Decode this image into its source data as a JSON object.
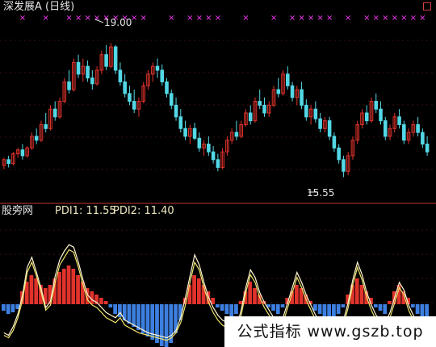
{
  "header": {
    "title": "深发展A (日线)",
    "corner_icon": "square-icon"
  },
  "chart_data": [
    {
      "type": "candlestick",
      "title": "深发展A (日线)",
      "annotations": {
        "high": "19.00",
        "low": "15.55"
      },
      "ylim": [
        15.0,
        19.4
      ],
      "colors": {
        "up": "#e0332c",
        "down": "#53d8e6",
        "marker": "#ff3cff"
      },
      "candles": [
        [
          15.85,
          16.05,
          15.75,
          16.0
        ],
        [
          16.0,
          16.1,
          15.8,
          15.9
        ],
        [
          15.9,
          16.2,
          15.85,
          16.15
        ],
        [
          16.15,
          16.3,
          16.05,
          16.25
        ],
        [
          16.25,
          16.4,
          16.0,
          16.1
        ],
        [
          16.1,
          16.35,
          16.05,
          16.3
        ],
        [
          16.3,
          16.7,
          16.25,
          16.6
        ],
        [
          16.6,
          16.8,
          16.4,
          16.5
        ],
        [
          16.5,
          17.0,
          16.45,
          16.9
        ],
        [
          16.9,
          17.2,
          16.7,
          16.8
        ],
        [
          16.8,
          17.4,
          16.75,
          17.3
        ],
        [
          17.3,
          17.5,
          17.0,
          17.1
        ],
        [
          17.1,
          17.6,
          17.05,
          17.5
        ],
        [
          17.5,
          18.1,
          17.45,
          18.0
        ],
        [
          18.0,
          18.3,
          17.7,
          17.8
        ],
        [
          17.8,
          18.6,
          17.75,
          18.5
        ],
        [
          18.5,
          18.7,
          18.1,
          18.2
        ],
        [
          18.2,
          18.6,
          18.0,
          18.4
        ],
        [
          18.4,
          18.55,
          18.0,
          18.1
        ],
        [
          18.1,
          18.3,
          17.8,
          17.95
        ],
        [
          17.95,
          18.4,
          17.9,
          18.3
        ],
        [
          18.3,
          18.8,
          18.2,
          18.7
        ],
        [
          18.7,
          18.95,
          18.3,
          18.4
        ],
        [
          18.4,
          19.0,
          18.35,
          18.9
        ],
        [
          18.9,
          18.95,
          18.2,
          18.3
        ],
        [
          18.3,
          18.5,
          17.9,
          18.0
        ],
        [
          18.0,
          18.2,
          17.6,
          17.7
        ],
        [
          17.7,
          17.9,
          17.4,
          17.5
        ],
        [
          17.5,
          17.8,
          17.2,
          17.3
        ],
        [
          17.3,
          17.6,
          17.1,
          17.5
        ],
        [
          17.5,
          18.0,
          17.45,
          17.9
        ],
        [
          17.9,
          18.3,
          17.8,
          18.2
        ],
        [
          18.2,
          18.5,
          18.0,
          18.4
        ],
        [
          18.4,
          18.6,
          18.1,
          18.3
        ],
        [
          18.3,
          18.45,
          17.9,
          18.0
        ],
        [
          18.0,
          18.1,
          17.6,
          17.7
        ],
        [
          17.7,
          17.8,
          17.3,
          17.4
        ],
        [
          17.4,
          17.6,
          17.0,
          17.1
        ],
        [
          17.1,
          17.3,
          16.7,
          16.8
        ],
        [
          16.8,
          17.0,
          16.5,
          16.6
        ],
        [
          16.6,
          16.9,
          16.4,
          16.8
        ],
        [
          16.8,
          16.95,
          16.5,
          16.55
        ],
        [
          16.55,
          16.7,
          16.2,
          16.3
        ],
        [
          16.3,
          16.5,
          16.1,
          16.4
        ],
        [
          16.4,
          16.6,
          16.1,
          16.2
        ],
        [
          16.2,
          16.35,
          15.9,
          16.0
        ],
        [
          16.0,
          16.15,
          15.7,
          15.8
        ],
        [
          15.8,
          16.3,
          15.75,
          16.2
        ],
        [
          16.2,
          16.6,
          16.1,
          16.5
        ],
        [
          16.5,
          16.8,
          16.4,
          16.7
        ],
        [
          16.7,
          17.0,
          16.5,
          16.6
        ],
        [
          16.6,
          17.0,
          16.55,
          16.9
        ],
        [
          16.9,
          17.3,
          16.85,
          17.2
        ],
        [
          17.2,
          17.4,
          16.9,
          17.0
        ],
        [
          17.0,
          17.6,
          16.95,
          17.5
        ],
        [
          17.5,
          17.8,
          17.3,
          17.4
        ],
        [
          17.4,
          17.6,
          17.1,
          17.2
        ],
        [
          17.2,
          17.5,
          17.1,
          17.4
        ],
        [
          17.4,
          17.9,
          17.35,
          17.8
        ],
        [
          17.8,
          18.1,
          17.6,
          17.7
        ],
        [
          17.7,
          18.3,
          17.65,
          18.2
        ],
        [
          18.2,
          18.4,
          17.8,
          17.9
        ],
        [
          17.9,
          18.0,
          17.5,
          17.6
        ],
        [
          17.6,
          17.9,
          17.4,
          17.8
        ],
        [
          17.8,
          18.0,
          17.3,
          17.4
        ],
        [
          17.4,
          17.55,
          17.0,
          17.1
        ],
        [
          17.1,
          17.4,
          16.9,
          17.3
        ],
        [
          17.3,
          17.5,
          16.95,
          17.05
        ],
        [
          17.05,
          17.2,
          16.7,
          16.8
        ],
        [
          16.8,
          17.1,
          16.7,
          17.0
        ],
        [
          17.0,
          17.1,
          16.5,
          16.6
        ],
        [
          16.6,
          16.7,
          16.2,
          16.3
        ],
        [
          16.3,
          16.4,
          15.9,
          16.0
        ],
        [
          16.0,
          16.1,
          15.55,
          15.7
        ],
        [
          15.7,
          16.2,
          15.6,
          16.1
        ],
        [
          16.1,
          16.6,
          16.0,
          16.5
        ],
        [
          16.5,
          17.0,
          16.4,
          16.9
        ],
        [
          16.9,
          17.3,
          16.8,
          17.2
        ],
        [
          17.2,
          17.4,
          16.9,
          17.0
        ],
        [
          17.0,
          17.6,
          16.95,
          17.5
        ],
        [
          17.5,
          17.7,
          17.2,
          17.3
        ],
        [
          17.3,
          17.5,
          16.9,
          17.0
        ],
        [
          17.0,
          17.1,
          16.5,
          16.6
        ],
        [
          16.6,
          16.9,
          16.5,
          16.8
        ],
        [
          16.8,
          17.2,
          16.7,
          17.1
        ],
        [
          17.1,
          17.3,
          16.8,
          16.9
        ],
        [
          16.9,
          17.0,
          16.4,
          16.5
        ],
        [
          16.5,
          16.8,
          16.4,
          16.7
        ],
        [
          16.7,
          17.0,
          16.6,
          16.9
        ],
        [
          16.9,
          17.1,
          16.6,
          16.7
        ],
        [
          16.7,
          16.8,
          16.3,
          16.4
        ],
        [
          16.4,
          16.6,
          16.1,
          16.2
        ]
      ]
    },
    {
      "type": "line",
      "ylim": [
        0,
        100
      ],
      "series": [
        {
          "name": "PDI1",
          "value_label": "11.55",
          "color": "#fff6d0",
          "values": [
            10,
            8,
            15,
            25,
            40,
            62,
            70,
            58,
            45,
            30,
            35,
            55,
            68,
            75,
            80,
            78,
            66,
            52,
            40,
            36,
            34,
            30,
            26,
            24,
            22,
            26,
            20,
            18,
            16,
            14,
            12,
            10,
            9,
            8,
            7,
            6,
            8,
            12,
            22,
            38,
            55,
            72,
            64,
            50,
            38,
            30,
            24,
            20,
            18,
            16,
            14,
            28,
            46,
            60,
            54,
            42,
            34,
            28,
            22,
            18,
            22,
            34,
            46,
            58,
            50,
            40,
            32,
            24,
            20,
            18,
            16,
            14,
            14,
            20,
            34,
            52,
            66,
            56,
            42,
            32,
            24,
            20,
            18,
            26,
            38,
            50,
            44,
            32,
            24,
            18,
            14,
            12
          ]
        },
        {
          "name": "PDI2",
          "value_label": "11.40",
          "color": "#f0e46a",
          "values": [
            8,
            6,
            12,
            22,
            36,
            58,
            66,
            55,
            42,
            28,
            32,
            50,
            64,
            70,
            76,
            74,
            62,
            48,
            36,
            32,
            30,
            26,
            22,
            20,
            18,
            22,
            16,
            14,
            12,
            10,
            9,
            8,
            7,
            6,
            5,
            4,
            6,
            10,
            18,
            32,
            50,
            66,
            60,
            46,
            34,
            26,
            20,
            16,
            14,
            12,
            10,
            24,
            42,
            56,
            50,
            38,
            30,
            24,
            18,
            14,
            18,
            30,
            42,
            54,
            46,
            36,
            28,
            20,
            16,
            14,
            12,
            11,
            11,
            16,
            30,
            48,
            62,
            52,
            38,
            28,
            20,
            16,
            14,
            22,
            34,
            46,
            40,
            28,
            20,
            14,
            11,
            11
          ]
        }
      ],
      "bars": {
        "colors": {
          "positive": "#e0332c",
          "negative": "#3d7fe0"
        },
        "values": [
          -4,
          -6,
          -5,
          -3,
          8,
          14,
          18,
          16,
          12,
          10,
          12,
          16,
          20,
          22,
          24,
          22,
          18,
          14,
          10,
          8,
          6,
          4,
          2,
          -2,
          -6,
          -8,
          -10,
          -12,
          -14,
          -16,
          -18,
          -20,
          -22,
          -24,
          -26,
          -28,
          -24,
          -18,
          -10,
          4,
          12,
          18,
          16,
          12,
          8,
          4,
          -2,
          -4,
          -6,
          -8,
          -6,
          2,
          8,
          14,
          10,
          6,
          2,
          -2,
          -4,
          -6,
          -2,
          4,
          8,
          12,
          10,
          6,
          2,
          -4,
          -6,
          -8,
          -10,
          -8,
          -6,
          -2,
          6,
          12,
          16,
          12,
          8,
          4,
          -2,
          -4,
          -6,
          2,
          8,
          12,
          8,
          4,
          -2,
          -6,
          -8,
          -10
        ]
      }
    }
  ],
  "indicator_panel": {
    "title": "股旁网",
    "pdi1_label": "PDI1: 11.55",
    "pdi2_label": "PDI2: 11.40"
  },
  "watermark": "公式指标 www.gszb.top"
}
